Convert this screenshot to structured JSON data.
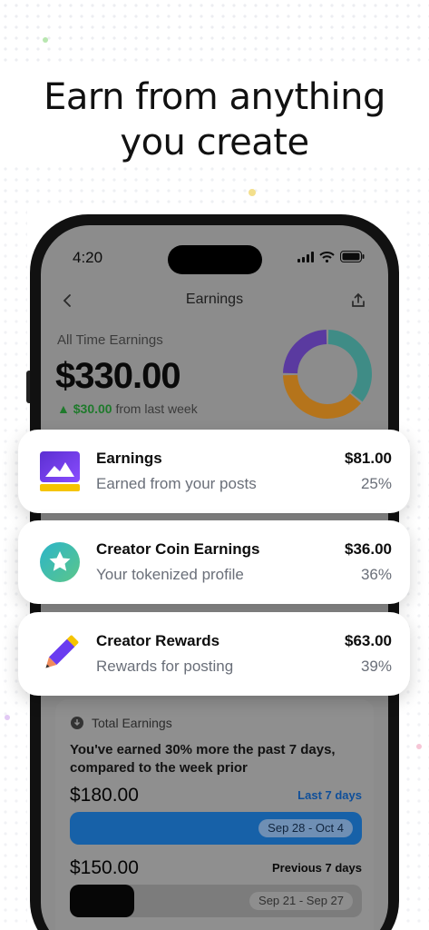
{
  "headline": [
    "Earn from anything",
    "you create"
  ],
  "status_bar": {
    "time": "4:20"
  },
  "nav": {
    "title": "Earnings"
  },
  "all_time": {
    "label": "All Time Earnings",
    "amount": "$330.00",
    "delta_value": "$30.00",
    "delta_text": "from last week"
  },
  "donut": {
    "segments": [
      {
        "name": "Creator Coin Earnings",
        "value": 36,
        "color": "#3f8c86"
      },
      {
        "name": "Creator Rewards",
        "value": 39,
        "color": "#b5741b"
      },
      {
        "name": "Earnings",
        "value": 25,
        "color": "#5a3aa0"
      }
    ]
  },
  "cards": [
    {
      "title": "Earnings",
      "subtitle": "Earned from your posts",
      "amount": "$81.00",
      "percent": "25%",
      "icon": "image-icon"
    },
    {
      "title": "Creator Coin Earnings",
      "subtitle": "Your tokenized profile",
      "amount": "$36.00",
      "percent": "36%",
      "icon": "star-coin-icon"
    },
    {
      "title": "Creator Rewards",
      "subtitle": "Rewards for posting",
      "amount": "$63.00",
      "percent": "39%",
      "icon": "pencil-icon"
    }
  ],
  "total": {
    "heading": "Total Earnings",
    "description": "You've earned 30% more the past 7 days, compared to the week prior",
    "current": {
      "amount": "$180.00",
      "label": "Last 7 days",
      "range": "Sep 28 - Oct 4",
      "fill": 1.0,
      "color": "#1761a8"
    },
    "previous": {
      "amount": "$150.00",
      "label": "Previous 7 days",
      "range": "Sep 21 - Sep 27",
      "fill": 0.22,
      "color": "#060606"
    }
  }
}
